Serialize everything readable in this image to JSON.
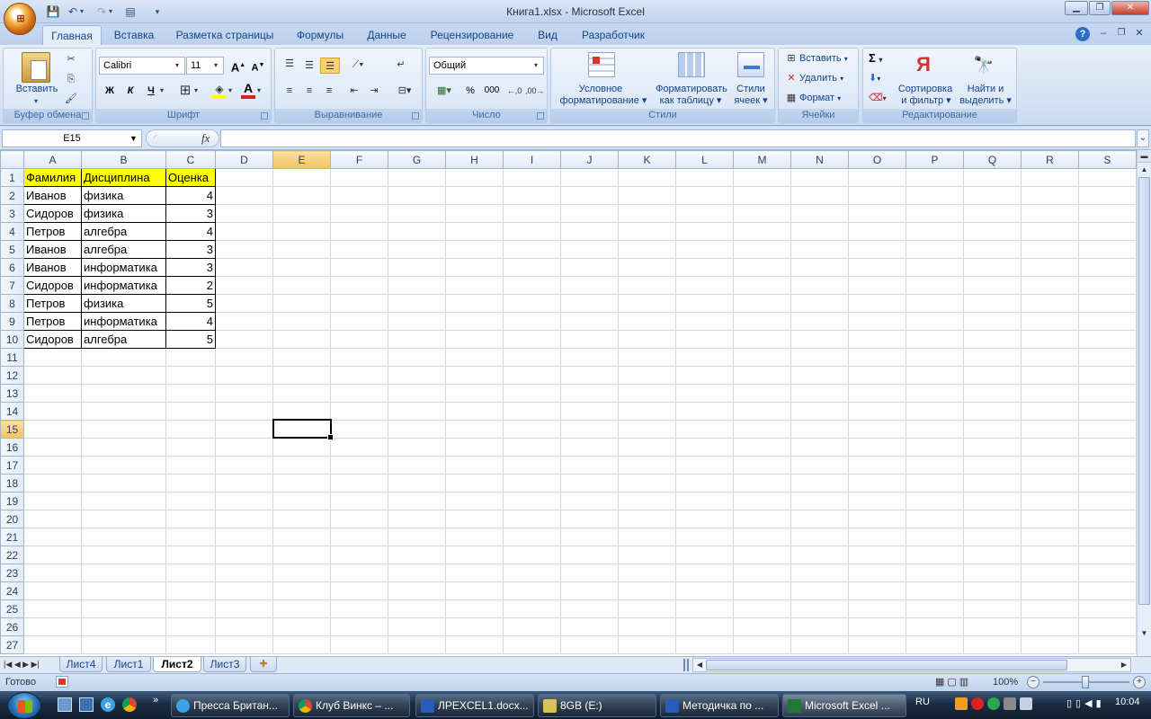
{
  "window": {
    "title": "Книга1.xlsx - Microsoft Excel"
  },
  "tabs": [
    "Главная",
    "Вставка",
    "Разметка страницы",
    "Формулы",
    "Данные",
    "Рецензирование",
    "Вид",
    "Разработчик"
  ],
  "ribbon": {
    "clipboard": {
      "label": "Буфер обмена",
      "paste": "Вставить"
    },
    "font": {
      "label": "Шрифт",
      "name": "Calibri",
      "size": "11",
      "bold": "Ж",
      "italic": "К",
      "underline": "Ч"
    },
    "alignment": {
      "label": "Выравнивание"
    },
    "number": {
      "label": "Число",
      "format": "Общий",
      "percent": "%",
      "thousands": "000"
    },
    "styles": {
      "label": "Стили",
      "conditional_1": "Условное",
      "conditional_2": "форматирование",
      "astable_1": "Форматировать",
      "astable_2": "как таблицу",
      "cellstyles_1": "Стили",
      "cellstyles_2": "ячеек"
    },
    "cells": {
      "label": "Ячейки",
      "insert": "Вставить",
      "delete": "Удалить",
      "format": "Формат"
    },
    "editing": {
      "label": "Редактирование",
      "sort_1": "Сортировка",
      "sort_2": "и фильтр",
      "find_1": "Найти и",
      "find_2": "выделить"
    }
  },
  "formula_bar": {
    "name_box": "E15",
    "fx": "fx",
    "content": ""
  },
  "columns": [
    "A",
    "B",
    "C",
    "D",
    "E",
    "F",
    "G",
    "H",
    "I",
    "J",
    "K",
    "L",
    "M",
    "N",
    "O",
    "P",
    "Q",
    "R",
    "S"
  ],
  "rows": [
    "1",
    "2",
    "3",
    "4",
    "5",
    "6",
    "7",
    "8",
    "9",
    "10",
    "11",
    "12",
    "13",
    "14",
    "15",
    "16",
    "17",
    "18",
    "19",
    "20",
    "21",
    "22",
    "23",
    "24",
    "25",
    "26",
    "27"
  ],
  "selected_cell": "E15",
  "table": {
    "headers": [
      "Фамилия",
      "Дисциплина",
      "Оценка"
    ],
    "data": [
      [
        "Иванов",
        "физика",
        "4"
      ],
      [
        "Сидоров",
        "физика",
        "3"
      ],
      [
        "Петров",
        "алгебра",
        "4"
      ],
      [
        "Иванов",
        "алгебра",
        "3"
      ],
      [
        "Иванов",
        "информатика",
        "3"
      ],
      [
        "Сидоров",
        "информатика",
        "2"
      ],
      [
        "Петров",
        "физика",
        "5"
      ],
      [
        "Петров",
        "информатика",
        "4"
      ],
      [
        "Сидоров",
        "алгебра",
        "5"
      ]
    ]
  },
  "sheets": [
    "Лист4",
    "Лист1",
    "Лист2",
    "Лист3"
  ],
  "active_sheet": "Лист2",
  "status": {
    "ready": "Готово",
    "zoom": "100%"
  },
  "taskbar": {
    "items": [
      "Пресса Британ...",
      "Клуб Винкс – ...",
      "ЛРEXCEL1.docx...",
      "8GB (E:)",
      "Методичка по ...",
      "Microsoft Excel ..."
    ],
    "lang": "RU",
    "clock": "10:04"
  },
  "colors": {
    "header_fill": "#ffff00",
    "selection_header": "#f5c260",
    "ribbon": "#dce7f6"
  }
}
